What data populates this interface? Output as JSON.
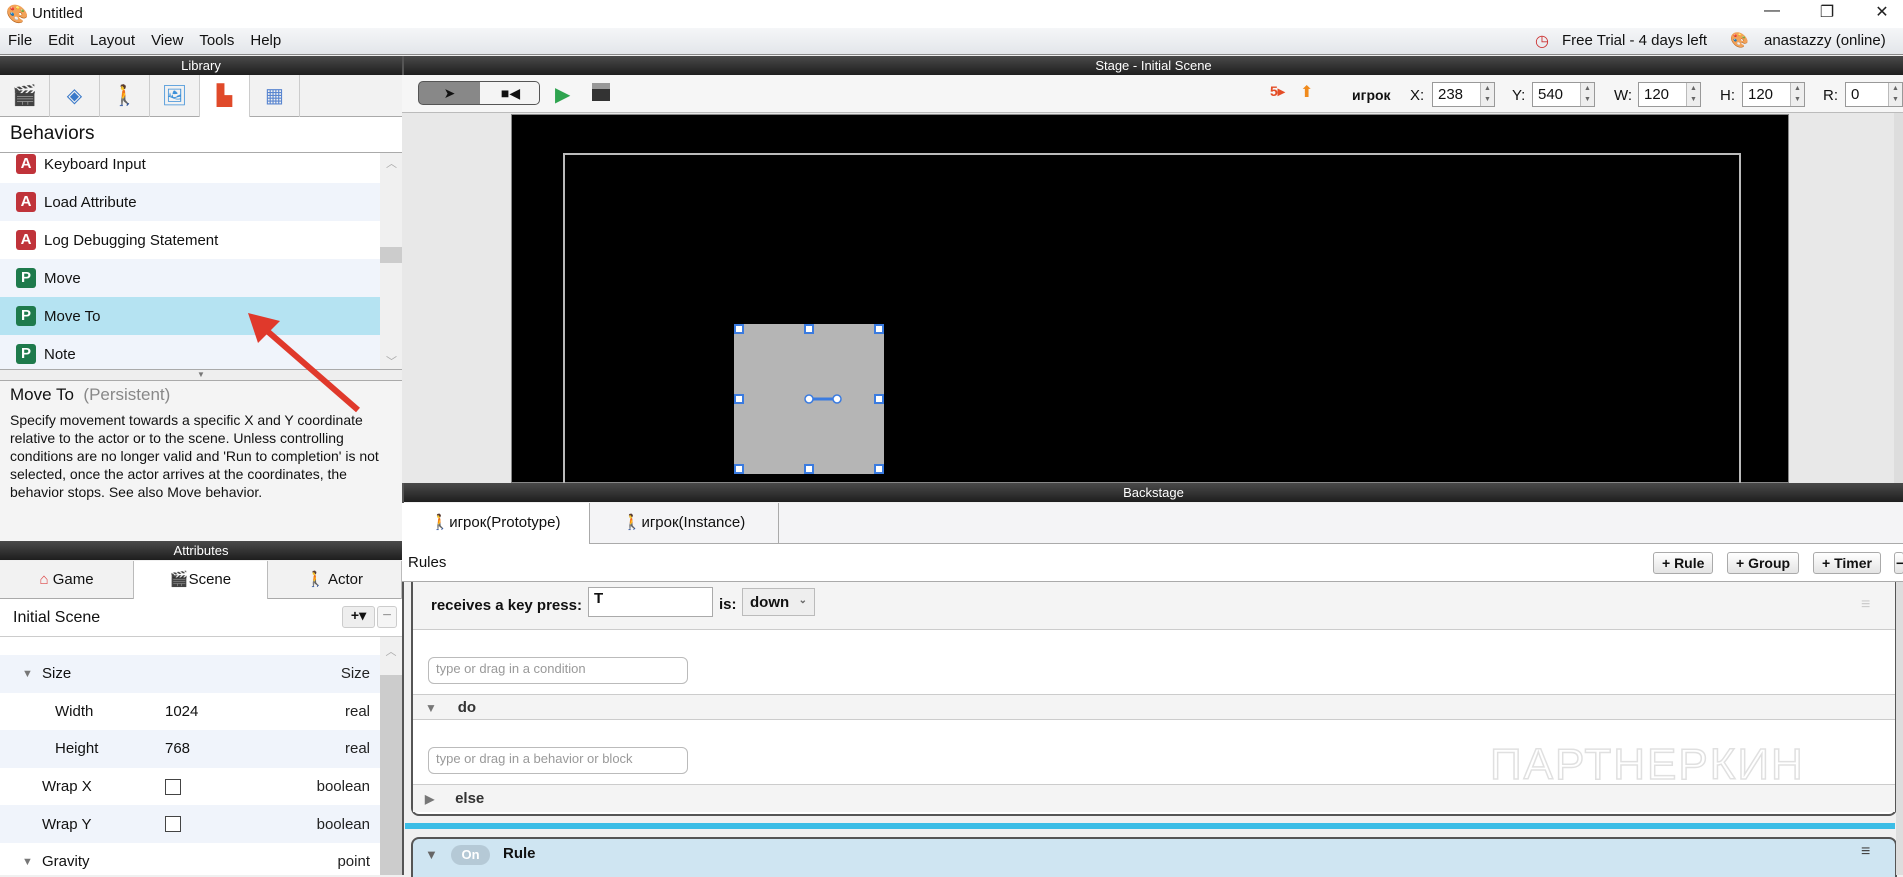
{
  "window": {
    "title": "Untitled",
    "minimize": "—",
    "maximize": "❐",
    "close": "✕"
  },
  "menu": [
    "File",
    "Edit",
    "Layout",
    "View",
    "Tools",
    "Help"
  ],
  "status": {
    "trial": "Free Trial - 4 days left",
    "user": "anastazzy (online)"
  },
  "library": {
    "header": "Library",
    "section": "Behaviors",
    "items": [
      {
        "badge": "A",
        "label": "Keyboard Input"
      },
      {
        "badge": "A",
        "label": "Load Attribute"
      },
      {
        "badge": "A",
        "label": "Log Debugging Statement"
      },
      {
        "badge": "P",
        "label": "Move"
      },
      {
        "badge": "P",
        "label": "Move To",
        "selected": true
      },
      {
        "badge": "P",
        "label": "Note"
      }
    ],
    "description": {
      "title": "Move To",
      "type": "(Persistent)",
      "text": "Specify movement towards a specific X and Y coordinate relative to the actor or to the scene. Unless controlling conditions are no longer valid and 'Run to completion' is not selected, once the actor arrives at the coordinates, the behavior stops. See also Move behavior."
    }
  },
  "attributes": {
    "header": "Attributes",
    "tabs": [
      "Game",
      "Scene",
      "Actor"
    ],
    "scene_name": "Initial Scene",
    "add": "+▾",
    "remove": "−",
    "rows": [
      {
        "name": "Size",
        "value": "",
        "type": "Size",
        "expand": "▼"
      },
      {
        "name": "Width",
        "value": "1024",
        "type": "real"
      },
      {
        "name": "Height",
        "value": "768",
        "type": "real"
      },
      {
        "name": "Wrap X",
        "value": "",
        "type": "boolean",
        "checkbox": true
      },
      {
        "name": "Wrap Y",
        "value": "",
        "type": "boolean",
        "checkbox": true
      },
      {
        "name": "Gravity",
        "value": "",
        "type": "point",
        "expand": "▼"
      }
    ]
  },
  "stage": {
    "header": "Stage - Initial Scene",
    "actor_name": "игрок",
    "x_label": "X:",
    "x": "238",
    "y_label": "Y:",
    "y": "540",
    "w_label": "W:",
    "w": "120",
    "h_label": "H:",
    "h": "120",
    "r_label": "R:",
    "r": "0"
  },
  "backstage": {
    "header": "Backstage",
    "tabs": [
      "игрок(Prototype)",
      "игрок(Instance)"
    ],
    "rules_label": "Rules",
    "buttons": [
      "+ Rule",
      "+ Group",
      "+ Timer"
    ],
    "rule": {
      "condition_label": "receives a key press:",
      "key": "T",
      "is_label": "is:",
      "state": "down",
      "condition_placeholder": "type or drag in a condition",
      "do_label": "do",
      "behavior_placeholder": "type or drag in a behavior or block",
      "else_label": "else"
    },
    "rule2": {
      "toggle": "On",
      "label": "Rule"
    }
  },
  "watermark": "ПАРТНЕРКИН",
  "colors": {
    "selected": "#b5e3f2",
    "accent": "#3bbde6",
    "rule_header": "#cfe5f2"
  }
}
